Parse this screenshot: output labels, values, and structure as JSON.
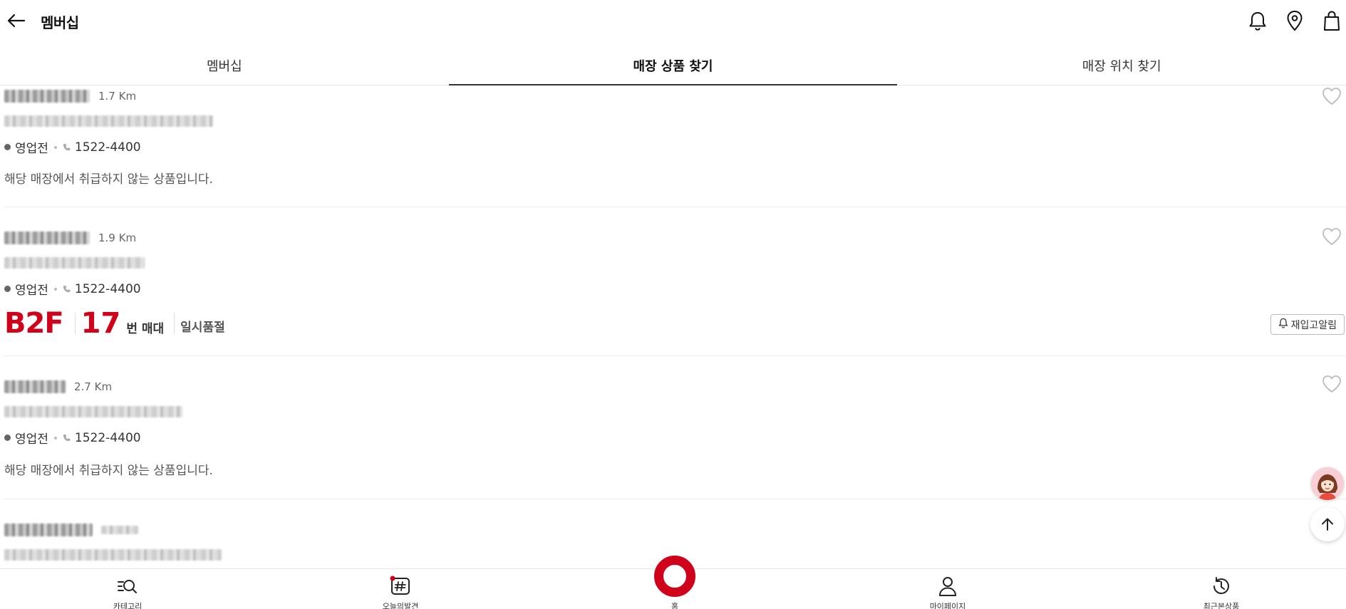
{
  "header": {
    "title": "멤버십"
  },
  "tabs": [
    {
      "label": "멤버십",
      "active": false
    },
    {
      "label": "매장 상품 찾기",
      "active": true
    },
    {
      "label": "매장 위치 찾기",
      "active": false
    }
  ],
  "stores": [
    {
      "distance": "1.7 Km",
      "status": "영업전",
      "phone": "1522-4400",
      "note": "해당 매장에서 취급하지 않는 상품입니다."
    },
    {
      "distance": "1.9 Km",
      "status": "영업전",
      "phone": "1522-4400",
      "floor": "B2F",
      "stand_no": "17",
      "stand_unit": "번 매대",
      "stock_status": "일시품절",
      "restock_label": "재입고알림"
    },
    {
      "distance": "2.7 Km",
      "status": "영업전",
      "phone": "1522-4400",
      "note": "해당 매장에서 취급하지 않는 상품입니다."
    }
  ],
  "bottom_nav": [
    {
      "label": "카테고리",
      "icon": "category-search-icon"
    },
    {
      "label": "오늘의발견",
      "icon": "hashtag-icon"
    },
    {
      "label": "홈",
      "icon": "home-ring-icon"
    },
    {
      "label": "마이페이지",
      "icon": "person-icon"
    },
    {
      "label": "최근본상품",
      "icon": "history-icon"
    }
  ],
  "colors": {
    "accent": "#d0021b",
    "text": "#222222",
    "divider": "#ececec"
  }
}
